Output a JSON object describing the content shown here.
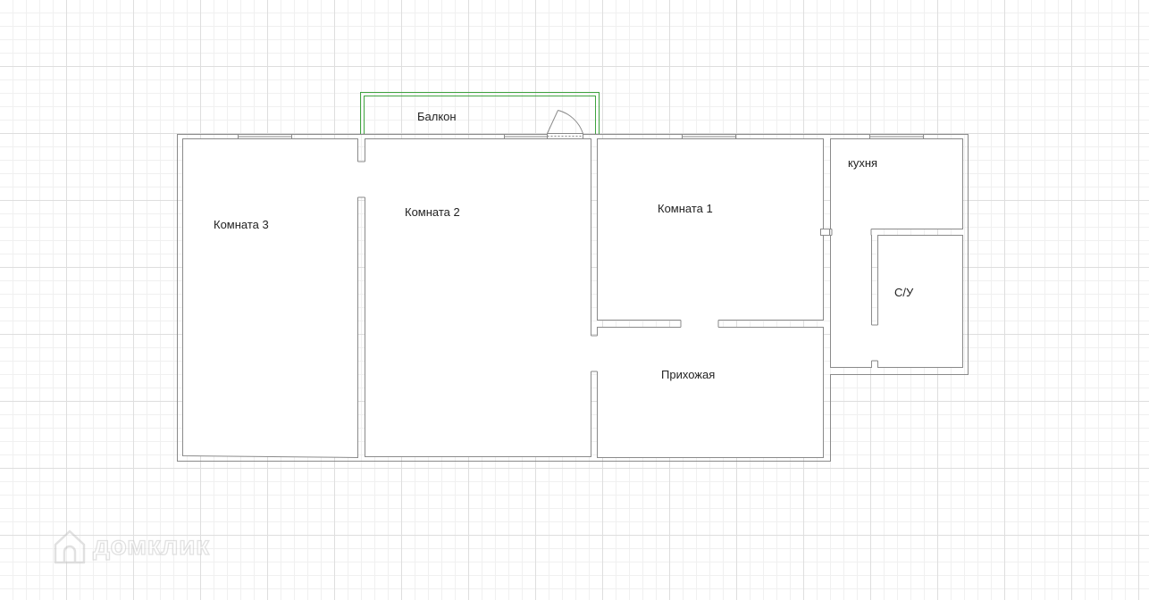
{
  "rooms": {
    "balcony": "Балкон",
    "room3": "Комната 3",
    "room2": "Комната 2",
    "room1": "Комната 1",
    "kitchen": "кухня",
    "bathroom": "С/У",
    "hallway": "Прихожая"
  },
  "watermark": {
    "text": "домклик",
    "icon": "house-icon"
  },
  "colors": {
    "wall": "#8a8a8a",
    "wall_fill": "#ffffff",
    "balcony_outline": "#3fa33f",
    "label": "#222222"
  }
}
